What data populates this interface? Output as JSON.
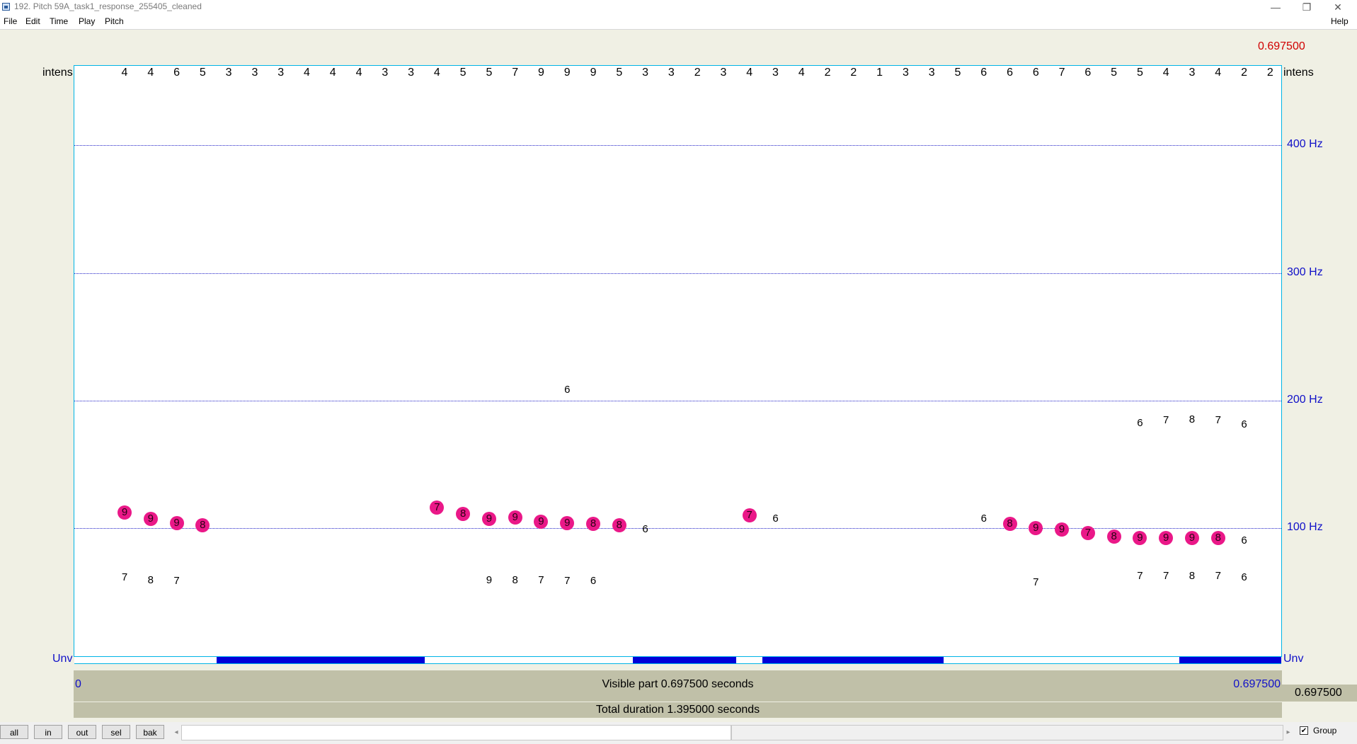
{
  "window": {
    "title": "192. Pitch 59A_task1_response_255405_cleaned",
    "minimize_glyph": "—",
    "restore_glyph": "❐",
    "close_glyph": "✕"
  },
  "menu": {
    "items": [
      "File",
      "Edit",
      "Time",
      "Play",
      "Pitch"
    ],
    "help": "Help"
  },
  "labels": {
    "intens_left": "intens",
    "intens_right": "intens",
    "unv_left": "Unv",
    "unv_right": "Unv",
    "cursor_time": "0.697500",
    "hz_400": "400 Hz",
    "hz_300": "300 Hz",
    "hz_200": "200 Hz",
    "hz_100": "100 Hz"
  },
  "axis": {
    "hz_min": 0,
    "hz_max": 465,
    "gridlines": [
      400,
      300,
      200,
      100
    ]
  },
  "intensity_row": [
    "4",
    "4",
    "6",
    "5",
    "3",
    "3",
    "3",
    "4",
    "4",
    "4",
    "3",
    "3",
    "4",
    "5",
    "5",
    "7",
    "9",
    "9",
    "9",
    "5",
    "3",
    "3",
    "2",
    "3",
    "4",
    "3",
    "4",
    "2",
    "2",
    "1",
    "3",
    "3",
    "5",
    "6",
    "6",
    "6",
    "7",
    "6",
    "5",
    "5",
    "4",
    "3",
    "4",
    "2",
    "2"
  ],
  "pitch_dots": [
    {
      "frame": 0,
      "hz": 112,
      "strength": "9"
    },
    {
      "frame": 1,
      "hz": 107,
      "strength": "9"
    },
    {
      "frame": 2,
      "hz": 104,
      "strength": "9"
    },
    {
      "frame": 3,
      "hz": 102,
      "strength": "8"
    },
    {
      "frame": 12,
      "hz": 116,
      "strength": "7"
    },
    {
      "frame": 13,
      "hz": 111,
      "strength": "8"
    },
    {
      "frame": 14,
      "hz": 107,
      "strength": "9"
    },
    {
      "frame": 15,
      "hz": 108,
      "strength": "9"
    },
    {
      "frame": 16,
      "hz": 105,
      "strength": "9"
    },
    {
      "frame": 17,
      "hz": 104,
      "strength": "9"
    },
    {
      "frame": 18,
      "hz": 103,
      "strength": "8"
    },
    {
      "frame": 19,
      "hz": 102,
      "strength": "8"
    },
    {
      "frame": 24,
      "hz": 110,
      "strength": "7"
    },
    {
      "frame": 34,
      "hz": 103,
      "strength": "8"
    },
    {
      "frame": 35,
      "hz": 100,
      "strength": "9"
    },
    {
      "frame": 36,
      "hz": 99,
      "strength": "9"
    },
    {
      "frame": 37,
      "hz": 96,
      "strength": "7"
    },
    {
      "frame": 38,
      "hz": 93,
      "strength": "8"
    },
    {
      "frame": 39,
      "hz": 92,
      "strength": "9"
    },
    {
      "frame": 40,
      "hz": 92,
      "strength": "9"
    },
    {
      "frame": 41,
      "hz": 92,
      "strength": "9"
    },
    {
      "frame": 42,
      "hz": 92,
      "strength": "8"
    }
  ],
  "candidates": [
    {
      "frame": 0,
      "hz": 61,
      "strength": "7"
    },
    {
      "frame": 1,
      "hz": 59,
      "strength": "8"
    },
    {
      "frame": 2,
      "hz": 58,
      "strength": "7"
    },
    {
      "frame": 14,
      "hz": 59,
      "strength": "9"
    },
    {
      "frame": 15,
      "hz": 59,
      "strength": "8"
    },
    {
      "frame": 16,
      "hz": 59,
      "strength": "7"
    },
    {
      "frame": 17,
      "hz": 58,
      "strength": "7"
    },
    {
      "frame": 18,
      "hz": 58,
      "strength": "6"
    },
    {
      "frame": 17,
      "hz": 208,
      "strength": "6"
    },
    {
      "frame": 20,
      "hz": 99,
      "strength": "6"
    },
    {
      "frame": 25,
      "hz": 107,
      "strength": "6"
    },
    {
      "frame": 33,
      "hz": 107,
      "strength": "6"
    },
    {
      "frame": 35,
      "hz": 57,
      "strength": "7"
    },
    {
      "frame": 39,
      "hz": 182,
      "strength": "6"
    },
    {
      "frame": 40,
      "hz": 184,
      "strength": "7"
    },
    {
      "frame": 41,
      "hz": 185,
      "strength": "8"
    },
    {
      "frame": 42,
      "hz": 184,
      "strength": "7"
    },
    {
      "frame": 43,
      "hz": 181,
      "strength": "6"
    },
    {
      "frame": 39,
      "hz": 62,
      "strength": "7"
    },
    {
      "frame": 40,
      "hz": 62,
      "strength": "7"
    },
    {
      "frame": 41,
      "hz": 62,
      "strength": "8"
    },
    {
      "frame": 42,
      "hz": 62,
      "strength": "7"
    },
    {
      "frame": 43,
      "hz": 61,
      "strength": "6"
    },
    {
      "frame": 43,
      "hz": 90,
      "strength": "6"
    }
  ],
  "unvoiced_segments": [
    {
      "start": 0.0823,
      "end": 0.2025
    },
    {
      "start": 0.3229,
      "end": 0.3825
    },
    {
      "start": 0.3975,
      "end": 0.5025
    },
    {
      "start": 0.6385,
      "end": 0.6975
    }
  ],
  "time": {
    "visible_start": 0,
    "visible_end": 0.6975,
    "start_label": "0",
    "end_label": "0.697500",
    "visible_text": "Visible part 0.697500 seconds",
    "side_text": "0.697500",
    "total_text": "Total duration 1.395000 seconds"
  },
  "zoom_buttons": [
    "all",
    "in",
    "out",
    "sel",
    "bak"
  ],
  "scroll": {
    "left_arrow": "◂",
    "right_arrow": "▸"
  },
  "group": {
    "checked": true,
    "check_glyph": "✔",
    "label": "Group"
  },
  "colors": {
    "pitch_dot": "#ea1888",
    "grid": "#2020c8",
    "unvoiced": "#0000d8",
    "frame_border": "#00b4e6"
  }
}
